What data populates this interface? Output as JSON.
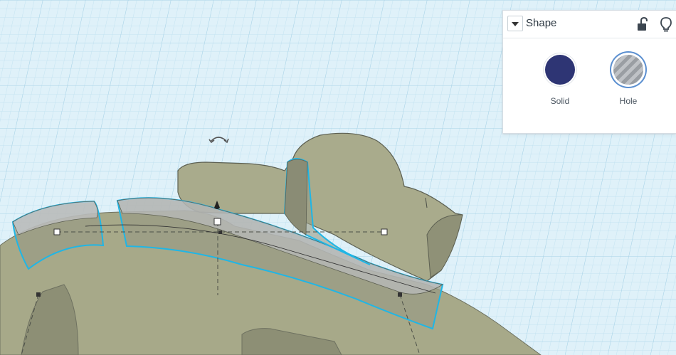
{
  "shape_panel": {
    "title": "Shape",
    "icons": {
      "dropdown": "chevron-down-icon",
      "lock": "unlock-icon",
      "hint": "lightbulb-icon"
    },
    "options": [
      {
        "key": "solid",
        "label": "Solid",
        "color": "#2e3574",
        "selected": false
      },
      {
        "key": "hole",
        "label": "Hole",
        "color": "#b8bcc0",
        "selected": true
      }
    ]
  },
  "workplane": {
    "grid_color": "#bfe0ef",
    "background": "#d9eef8",
    "shape_color": "#a9ab8c",
    "selection_outline": "#1fb6e6"
  }
}
